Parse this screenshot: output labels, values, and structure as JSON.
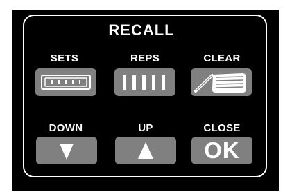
{
  "panel": {
    "title": "RECALL"
  },
  "buttons": {
    "sets": {
      "label": "SETS",
      "icon": "sets-bars-icon"
    },
    "reps": {
      "label": "REPS",
      "icon": "reps-bars-icon"
    },
    "clear": {
      "label": "CLEAR",
      "icon": "eraser-icon"
    },
    "down": {
      "label": "DOWN",
      "icon": "down-triangle-icon"
    },
    "up": {
      "label": "UP",
      "icon": "up-triangle-icon"
    },
    "close": {
      "label": "CLOSE",
      "text": "OK"
    }
  },
  "colors": {
    "background": "#000000",
    "button": "#808080",
    "text": "#ffffff"
  }
}
